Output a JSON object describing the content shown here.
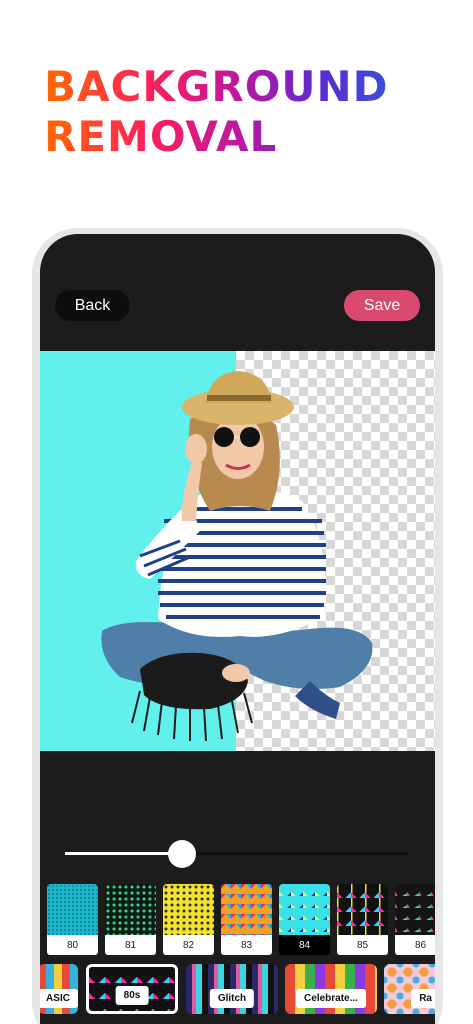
{
  "headline": {
    "line1": "BACKGROUND",
    "line2": "REMOVAL"
  },
  "toolbar": {
    "back_label": "Back",
    "save_label": "Save"
  },
  "slider": {
    "value": 0.34
  },
  "patterns": [
    {
      "label": "80",
      "selected": false
    },
    {
      "label": "81",
      "selected": false
    },
    {
      "label": "82",
      "selected": false
    },
    {
      "label": "83",
      "selected": false
    },
    {
      "label": "84",
      "selected": true
    },
    {
      "label": "85",
      "selected": false
    },
    {
      "label": "86",
      "selected": false
    }
  ],
  "categories": [
    {
      "label": "ASIC"
    },
    {
      "label": "80s"
    },
    {
      "label": "Glitch"
    },
    {
      "label": "Celebrate..."
    },
    {
      "label": "Ra"
    }
  ],
  "colors": {
    "accent": "#d94a6e",
    "canvas_bg": "#62f0ec",
    "screen_bg": "#1c1c1c"
  }
}
